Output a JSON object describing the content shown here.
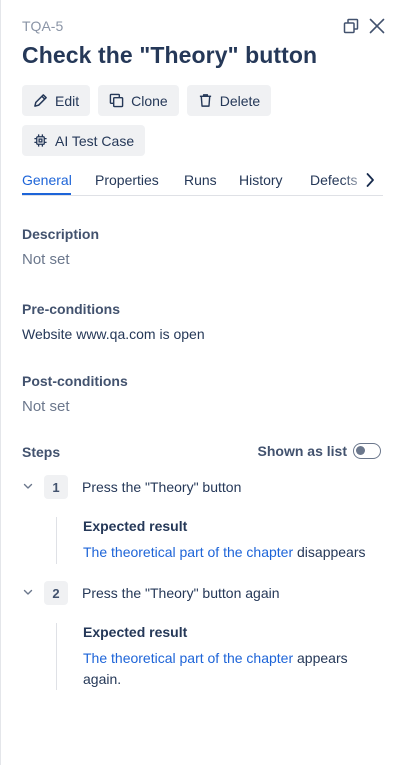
{
  "header": {
    "case_id": "TQA-5",
    "title": "Check the \"Theory\" button"
  },
  "actions": {
    "edit": "Edit",
    "clone": "Clone",
    "delete": "Delete",
    "ai_test_case": "AI Test Case"
  },
  "tabs": [
    {
      "label": "General",
      "active": true
    },
    {
      "label": "Properties",
      "active": false
    },
    {
      "label": "Runs",
      "active": false
    },
    {
      "label": "History",
      "active": false
    },
    {
      "label": "Defects",
      "active": false
    }
  ],
  "description": {
    "label": "Description",
    "value": "Not set"
  },
  "preconditions": {
    "label": "Pre-conditions",
    "value": "Website www.qa.com is open"
  },
  "postconditions": {
    "label": "Post-conditions",
    "value": "Not set"
  },
  "steps": {
    "label": "Steps",
    "toggle_label": "Shown as list",
    "toggle_on": false,
    "items": [
      {
        "number": "1",
        "action": "Press the \"Theory\" button",
        "expected_label": "Expected result",
        "expected_link": "The theoretical part of the chapter",
        "expected_rest": " disappears"
      },
      {
        "number": "2",
        "action": "Press the \"Theory\" button again",
        "expected_label": "Expected result",
        "expected_link": "The theoretical part of the chapter",
        "expected_rest": " appears again."
      }
    ]
  },
  "colors": {
    "accent": "#1d64d8",
    "text": "#253858",
    "muted": "#6b778c",
    "button_bg": "#f0f1f3"
  },
  "icons": [
    "restore-window-icon",
    "close-icon",
    "pencil-icon",
    "copy-icon",
    "trash-icon",
    "chip-icon",
    "chevron-right-icon",
    "chevron-down-icon"
  ]
}
